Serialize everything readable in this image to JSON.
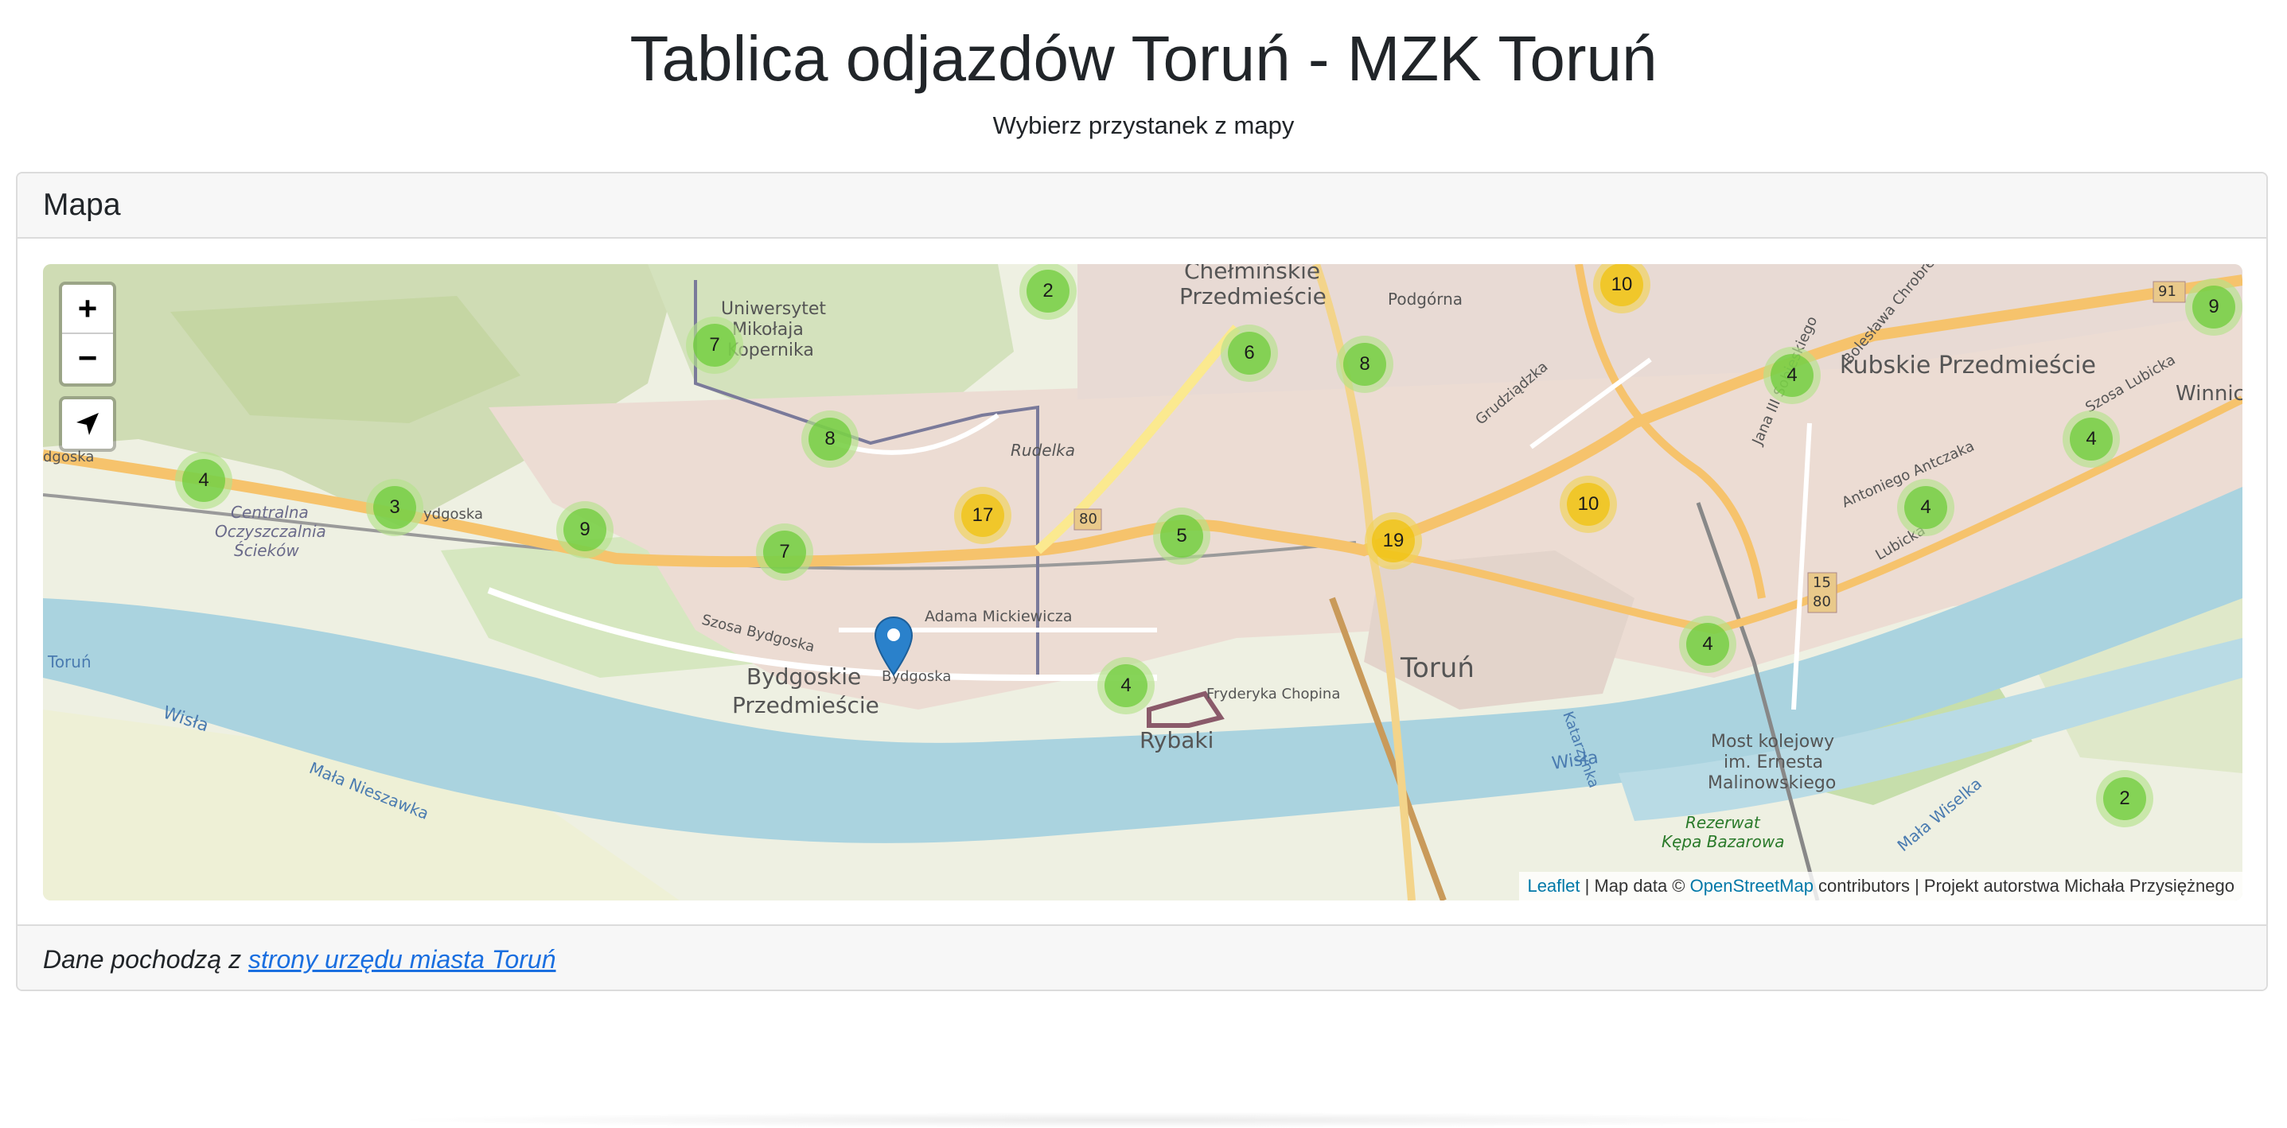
{
  "header": {
    "title": "Tablica odjazdów Toruń - MZK Toruń",
    "subtitle": "Wybierz przystanek z mapy"
  },
  "card": {
    "title": "Mapa",
    "footer": {
      "prefix": "Dane pochodzą z ",
      "link_text": "strony urzędu miasta Toruń"
    }
  },
  "map": {
    "zoom_in": "+",
    "zoom_out": "−",
    "locate_icon": "navigation-arrow-icon",
    "attribution": {
      "leaflet": "Leaflet",
      "sep1": " | Map data © ",
      "osm": "OpenStreetMap",
      "rest": " contributors | Projekt autorstwa Michała Przysiężnego"
    },
    "place_labels": {
      "chelminskie1": "Chełmińskie",
      "chelminskie2": "Przedmieście",
      "podgorna": "Podgórna",
      "uni1": "Uniwersytet",
      "uni2": "Mikołaja",
      "uni3": "Kopernika",
      "jakubskie": "kubskie Przedmieście",
      "winnica": "Winnic",
      "bydgoska_w": "dgoska",
      "bydgoska2": "ydgoska",
      "centralna1": "Centralna",
      "centralna2": "Oczyszczalnia",
      "centralna3": "Ścieków",
      "rudelka": "Rudelka",
      "mickiewicza": "Adama Mickiewicza",
      "szosa_bydgoska": "Szosa Bydgoska",
      "bydgoskie1": "Bydgoskie",
      "bydgoskie2": "Przedmieście",
      "bydgoska_street": "Bydgoska",
      "chopina": "Fryderyka Chopina",
      "rybaki": "Rybaki",
      "torun": "Toruń",
      "torun_w": "Toruń",
      "wisla": "Wisła",
      "wisla2": "Wisła",
      "mala_nieszawka": "Mała Nieszawka",
      "most1": "Most kolejowy",
      "most2": "im. Ernesta",
      "most3": "Malinowskiego",
      "rezerwat1": "Rezerwat",
      "rezerwat2": "Kępa Bazarowa",
      "mala_wiselka": "Mała Wiselka",
      "katarzynka": "Katarzynka",
      "grudziadzka": "Grudziądzka",
      "szosa_lubicka": "Szosa Lubicka",
      "antoniego": "Antoniego Antczaka",
      "lubicka": "Lubicka",
      "jana3": "Jana III Sobieskiego",
      "chrobrego": "Bolesława Chrobrego",
      "route80": "80",
      "route91": "91",
      "route15": "15",
      "route80b": "80"
    },
    "clusters": [
      {
        "count": "2",
        "size": "small"
      },
      {
        "count": "10",
        "size": "medium"
      },
      {
        "count": "9",
        "size": "small"
      },
      {
        "count": "7",
        "size": "small"
      },
      {
        "count": "6",
        "size": "small"
      },
      {
        "count": "8",
        "size": "small"
      },
      {
        "count": "4",
        "size": "small"
      },
      {
        "count": "8",
        "size": "small"
      },
      {
        "count": "4",
        "size": "small"
      },
      {
        "count": "4",
        "size": "small"
      },
      {
        "count": "3",
        "size": "small"
      },
      {
        "count": "9",
        "size": "small"
      },
      {
        "count": "17",
        "size": "medium"
      },
      {
        "count": "7",
        "size": "small"
      },
      {
        "count": "5",
        "size": "small"
      },
      {
        "count": "19",
        "size": "medium"
      },
      {
        "count": "10",
        "size": "medium"
      },
      {
        "count": "4",
        "size": "small"
      },
      {
        "count": "4",
        "size": "small"
      },
      {
        "count": "4",
        "size": "small"
      },
      {
        "count": "2",
        "size": "small"
      }
    ]
  }
}
